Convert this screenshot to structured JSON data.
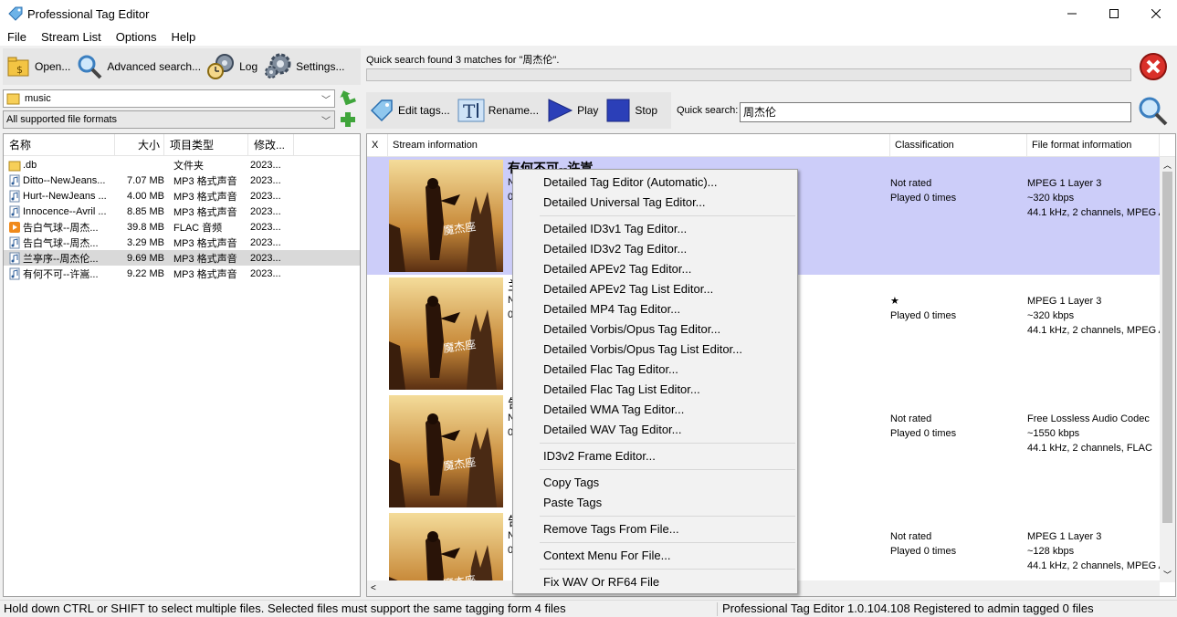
{
  "window": {
    "title": "Professional Tag Editor"
  },
  "menu": [
    "File",
    "Stream List",
    "Options",
    "Help"
  ],
  "left_toolbar": {
    "open": "Open...",
    "advanced_search": "Advanced search...",
    "log": "Log",
    "settings": "Settings..."
  },
  "folder_combo": {
    "value": "music"
  },
  "format_combo": {
    "value": "All supported file formats"
  },
  "file_list": {
    "headers": [
      "名称",
      "大小",
      "项目类型",
      "修改..."
    ],
    "rows": [
      {
        "name": ".db",
        "size": "",
        "type": "文件夹",
        "modified": "2023...",
        "icon": "folder-icon"
      },
      {
        "name": "Ditto--NewJeans...",
        "size": "7.07 MB",
        "type": "MP3 格式声音",
        "modified": "2023...",
        "icon": "music-file-icon"
      },
      {
        "name": "Hurt--NewJeans ...",
        "size": "4.00 MB",
        "type": "MP3 格式声音",
        "modified": "2023...",
        "icon": "music-file-icon"
      },
      {
        "name": "Innocence--Avril ...",
        "size": "8.85 MB",
        "type": "MP3 格式声音",
        "modified": "2023...",
        "icon": "music-file-icon"
      },
      {
        "name": "告白气球--周杰...",
        "size": "39.8 MB",
        "type": "FLAC 音频",
        "modified": "2023...",
        "icon": "flac-file-icon"
      },
      {
        "name": "告白气球--周杰...",
        "size": "3.29 MB",
        "type": "MP3 格式声音",
        "modified": "2023...",
        "icon": "music-file-icon"
      },
      {
        "name": "兰亭序--周杰伦...",
        "size": "9.69 MB",
        "type": "MP3 格式声音",
        "modified": "2023...",
        "icon": "music-file-icon",
        "selected": true
      },
      {
        "name": "有何不可--许嵩...",
        "size": "9.22 MB",
        "type": "MP3 格式声音",
        "modified": "2023...",
        "icon": "music-file-icon"
      }
    ]
  },
  "search_status": "Quick search found 3 matches for \"周杰伦\".",
  "right_toolbar": {
    "edit_tags": "Edit tags...",
    "rename": "Rename...",
    "play": "Play",
    "stop": "Stop"
  },
  "quick_search": {
    "label": "Quick search:",
    "value": "周杰伦"
  },
  "grid": {
    "headers": [
      "X",
      "Stream information",
      "Classification",
      "File format information"
    ],
    "rows": [
      {
        "title": "有何不可--许嵩",
        "snippet": [
          "N",
          "0"
        ],
        "classification": [
          "Not rated",
          "Played 0 times"
        ],
        "format": [
          "MPEG 1 Layer 3",
          "~320 kbps",
          "44.1 kHz, 2 channels, MPEG A"
        ],
        "selected": true
      },
      {
        "title": "",
        "snippet": [
          "兰",
          "N",
          "0"
        ],
        "classification": [
          "★",
          "Played 0 times"
        ],
        "format": [
          "MPEG 1 Layer 3",
          "~320 kbps",
          "44.1 kHz, 2 channels, MPEG A"
        ]
      },
      {
        "title": "",
        "snippet": [
          "告",
          "N",
          "0"
        ],
        "classification": [
          "Not rated",
          "Played 0 times"
        ],
        "format": [
          "Free Lossless Audio Codec",
          "~1550 kbps",
          "44.1 kHz, 2 channels, FLAC"
        ]
      },
      {
        "title": "",
        "snippet": [
          "告",
          "N",
          "0"
        ],
        "classification": [
          "Not rated",
          "Played 0 times"
        ],
        "format": [
          "MPEG 1 Layer 3",
          "~128 kbps",
          "44.1 kHz, 2 channels, MPEG A"
        ]
      }
    ]
  },
  "context_menu": {
    "groups": [
      [
        "Detailed Tag Editor (Automatic)...",
        "Detailed Universal Tag Editor..."
      ],
      [
        "Detailed ID3v1 Tag Editor...",
        "Detailed ID3v2 Tag Editor...",
        "Detailed APEv2 Tag Editor...",
        "Detailed APEv2 Tag List Editor...",
        "Detailed MP4 Tag Editor...",
        "Detailed Vorbis/Opus Tag Editor...",
        "Detailed Vorbis/Opus Tag List Editor...",
        "Detailed Flac Tag Editor...",
        "Detailed Flac Tag List Editor...",
        "Detailed WMA Tag Editor...",
        "Detailed WAV Tag Editor..."
      ],
      [
        "ID3v2 Frame Editor..."
      ],
      [
        "Copy Tags",
        "Paste Tags"
      ],
      [
        "Remove Tags From File..."
      ],
      [
        "Context Menu For File..."
      ],
      [
        "Fix WAV Or RF64 File"
      ]
    ]
  },
  "statusbar": {
    "left": "Hold down CTRL or SHIFT to select multiple files. Selected files must support the same tagging form 4 files",
    "right": "Professional Tag Editor 1.0.104.108 Registered to admin tagged 0 files"
  }
}
